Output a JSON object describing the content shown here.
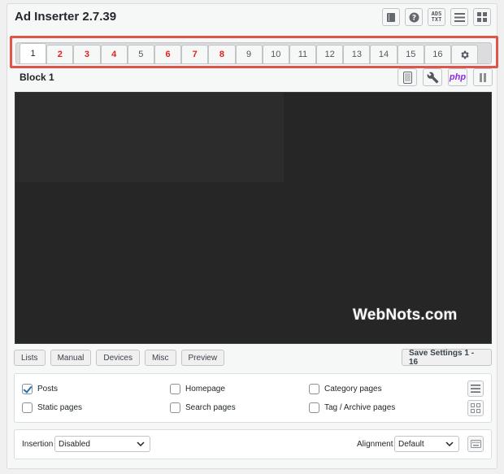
{
  "app": {
    "title": "Ad Inserter 2.7.39"
  },
  "header_icons": [
    "book-icon",
    "help-icon",
    "ads-txt-icon",
    "list-icon",
    "grid-icon"
  ],
  "ads_txt": {
    "line1": "ADS",
    "line2": "TXT"
  },
  "tabs": [
    {
      "label": "1",
      "active": true,
      "color": "default"
    },
    {
      "label": "2",
      "color": "red"
    },
    {
      "label": "3",
      "color": "red"
    },
    {
      "label": "4",
      "color": "red"
    },
    {
      "label": "5"
    },
    {
      "label": "6",
      "color": "red"
    },
    {
      "label": "7",
      "color": "red"
    },
    {
      "label": "8",
      "color": "red"
    },
    {
      "label": "9"
    },
    {
      "label": "10"
    },
    {
      "label": "11"
    },
    {
      "label": "12"
    },
    {
      "label": "13"
    },
    {
      "label": "14"
    },
    {
      "label": "15"
    },
    {
      "label": "16"
    }
  ],
  "block": {
    "title": "Block 1",
    "php_label": "php"
  },
  "watermark": "WebNots.com",
  "buttons": {
    "lists": "Lists",
    "manual": "Manual",
    "devices": "Devices",
    "misc": "Misc",
    "preview": "Preview",
    "save": "Save Settings 1 - 16"
  },
  "options": {
    "posts": "Posts",
    "static_pages": "Static pages",
    "homepage": "Homepage",
    "search_pages": "Search pages",
    "category_pages": "Category pages",
    "tag_archive_pages": "Tag / Archive pages"
  },
  "insertion": {
    "label": "Insertion",
    "value": "Disabled",
    "alignment_label": "Alignment",
    "alignment_value": "Default"
  },
  "colors": {
    "highlight": "#e0544c",
    "tab_red": "#e2231a",
    "php": "#8a2be2",
    "editor_bg": "#262626"
  }
}
